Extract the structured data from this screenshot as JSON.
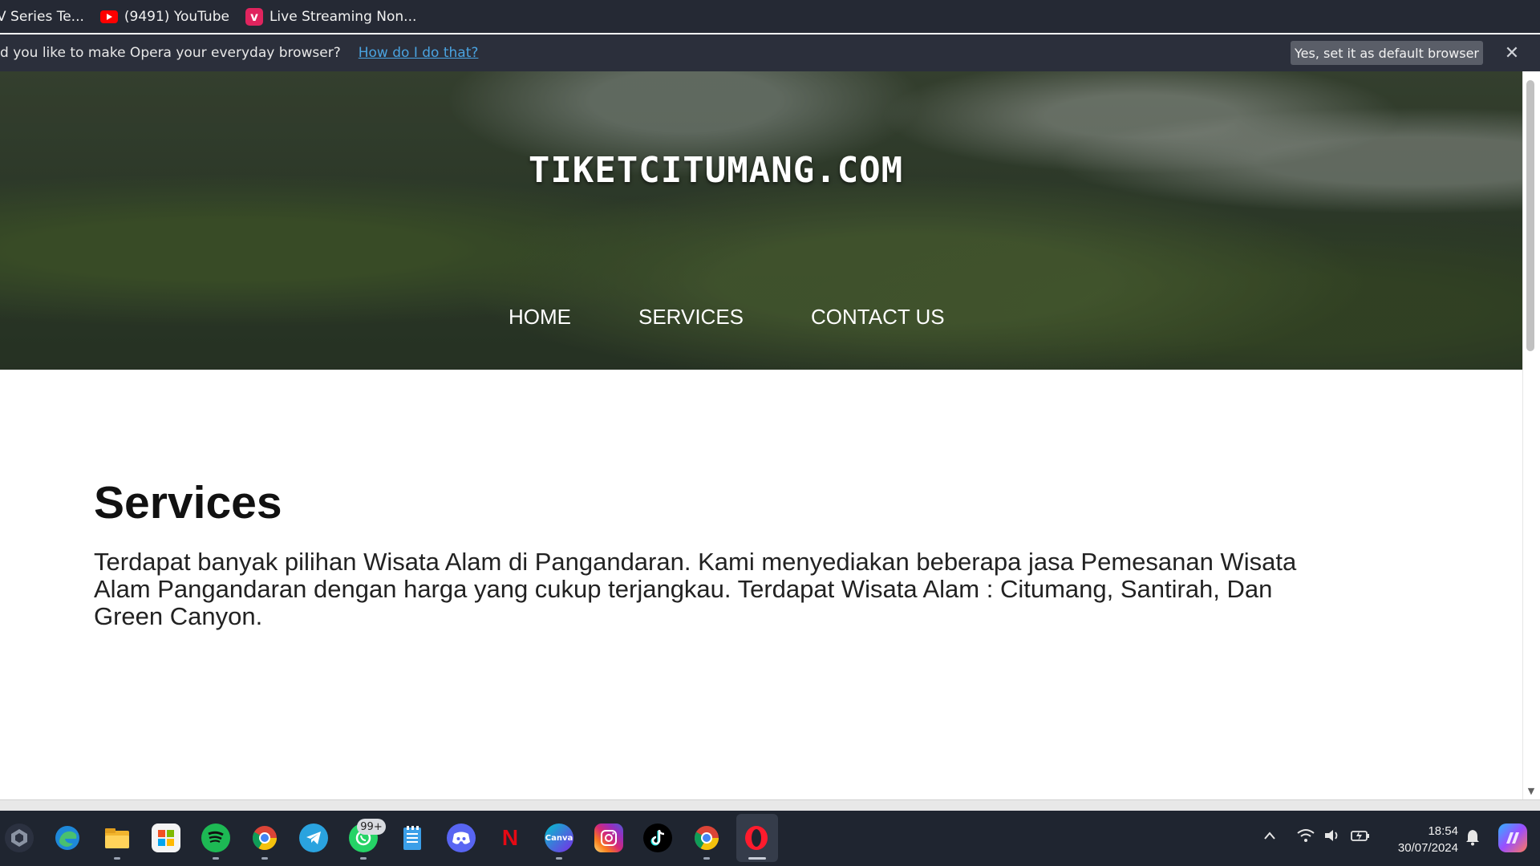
{
  "browser": {
    "bookmarks": [
      {
        "label": "V Series Te...",
        "icon": "none"
      },
      {
        "label": "(9491) YouTube",
        "icon": "youtube-icon"
      },
      {
        "label": "Live Streaming Non...",
        "icon": "vidio-icon"
      }
    ],
    "infobar": {
      "message": "d you like to make Opera your everyday browser?",
      "link": "How do I do that?",
      "button": "Yes, set it as default browser",
      "close": "✕"
    }
  },
  "page": {
    "site_title": "TIKETCITUMANG.COM",
    "nav": [
      "HOME",
      "SERVICES",
      "CONTACT US"
    ],
    "services_heading": "Services",
    "services_text": "Terdapat banyak pilihan Wisata Alam di Pangandaran. Kami menyediakan beberapa jasa Pemesanan Wisata Alam Pangandaran dengan harga yang cukup terjangkau. Terdapat Wisata Alam : Citumang, Santirah, Dan Green Canyon."
  },
  "taskbar": {
    "apps": [
      "start-icon",
      "edge-icon",
      "file-explorer-icon",
      "store-icon",
      "spotify-icon",
      "chrome-icon",
      "telegram-icon",
      "whatsapp-icon",
      "notepad-icon",
      "discord-icon",
      "netflix-icon",
      "canva-icon",
      "instagram-icon",
      "tiktok-icon",
      "chrome-icon",
      "opera-icon"
    ],
    "whatsapp_badge": "99+",
    "time": "18:54",
    "date": "30/07/2024"
  }
}
